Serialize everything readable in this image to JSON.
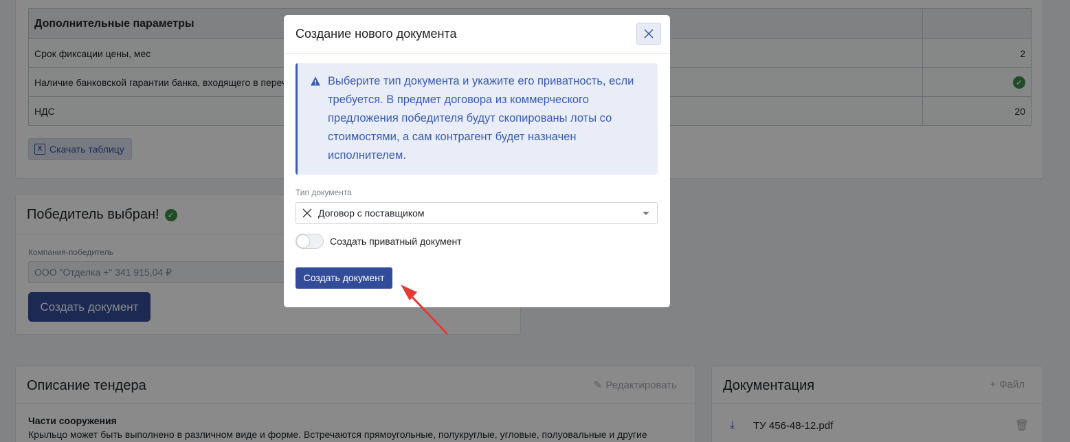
{
  "params": {
    "header": "Дополнительные параметры",
    "rows": [
      {
        "label": "Срок фиксации цены, мес",
        "value": "2"
      },
      {
        "label": "Наличие банковской гарантии банка, входящего в перечень",
        "value": "check"
      },
      {
        "label": "НДС",
        "value": "20"
      }
    ],
    "download_label": "Скачать таблицу"
  },
  "winner": {
    "title": "Победитель выбран!",
    "company_label": "Компания-победитель",
    "company_value": "ООО \"Отделка +\" 341 915,04 ₽",
    "create_button": "Создать документ"
  },
  "tender": {
    "title": "Описание тендера",
    "edit_label": "Редактировать",
    "section_title": "Части сооружения",
    "section_text": "Крыльцо может быть выполнено в различном виде и форме. Встречаются прямоугольные, полукруглые, угловые, полуовальные и другие"
  },
  "docs": {
    "title": "Документация",
    "add_label": "Файл",
    "files": [
      {
        "name": "ТУ 456-48-12.pdf"
      }
    ]
  },
  "modal": {
    "title": "Создание нового документа",
    "alert_text": "Выберите тип документа и укажите его приватность, если требуется. В предмет договора из коммерческого предложения победителя будут скопированы лоты со стоимостями, а сам контрагент будет назначен исполнителем.",
    "type_label": "Тип документа",
    "type_value": "Договор с поставщиком",
    "private_label": "Создать приватный документ",
    "private_enabled": false,
    "create_button": "Создать документ"
  },
  "colors": {
    "primary": "#324c99",
    "alert_text": "#3a5bb0",
    "success": "#3a8f4b",
    "annotation_arrow": "#e53935"
  }
}
